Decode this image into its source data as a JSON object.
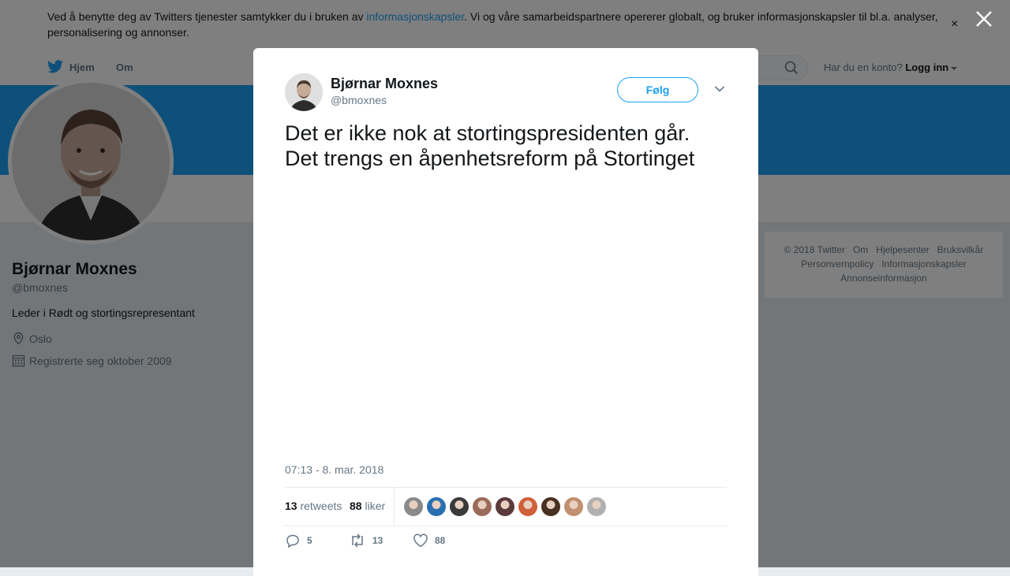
{
  "cookie_banner": {
    "text_before": "Ved å benytte deg av Twitters tjenester samtykker du i bruken av ",
    "link": "informasjonskapsler",
    "text_after": ". Vi og våre samarbeidspartnere opererer globalt, og bruker informasjonskapsler til bl.a. analyser, personalisering og annonser.",
    "close": "×"
  },
  "nav": {
    "home": "Hjem",
    "about": "Om",
    "account_prompt": "Har du en konto?",
    "login": "Logg inn"
  },
  "profile": {
    "name": "Bjørnar Moxnes",
    "handle": "@bmoxnes",
    "bio": "Leder i Rødt og stortingsrepresentant",
    "location": "Oslo",
    "joined": "Registrerte seg oktober 2009"
  },
  "footer": {
    "row1": [
      "© 2018 Twitter",
      "Om",
      "Hjelpesenter",
      "Bruksvilkår"
    ],
    "row2": [
      "Personvernpolicy",
      "Informasjonskapsler"
    ],
    "row3": [
      "Annonseinformasjon"
    ]
  },
  "tweet": {
    "author_name": "Bjørnar Moxnes",
    "author_handle": "@bmoxnes",
    "follow_label": "Følg",
    "text_line1": "Det er ikke nok at stortingspresidenten går.",
    "text_line2": "Det trengs en åpenhetsreform på Stortinget",
    "timestamp": "07:13 - 8. mar. 2018",
    "retweets_count": "13",
    "retweets_label": "retweets",
    "likes_count": "88",
    "likes_label": "liker",
    "replies": "5",
    "retweets": "13",
    "likes": "88",
    "liker_face_colors": [
      "#8a8a8a",
      "#2a6fb0",
      "#3a3a3a",
      "#9b6b5a",
      "#5a3a3a",
      "#d0603a",
      "#4a3020",
      "#c09070",
      "#b0b0b0"
    ]
  },
  "colors": {
    "accent": "#1da1f2",
    "banner": "#1da1f2"
  }
}
